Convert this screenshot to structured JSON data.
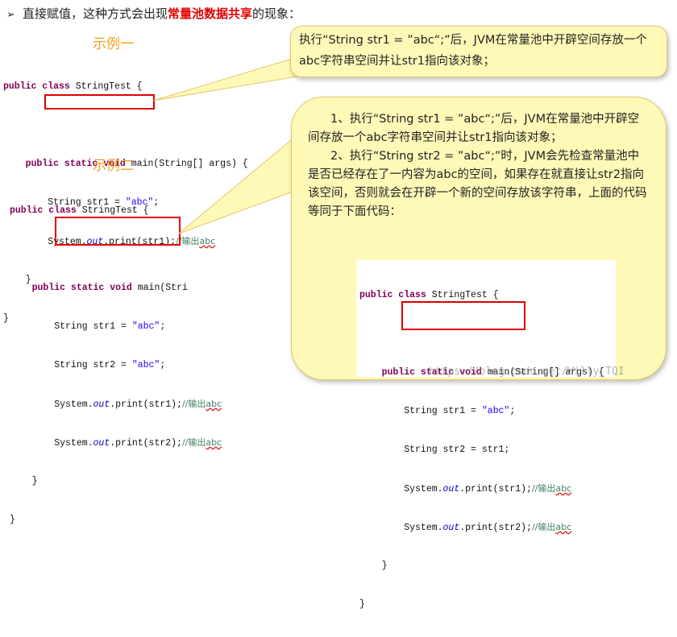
{
  "header": {
    "arrow": "➢",
    "prefix": "直接赋值，这种方式会出现",
    "highlight": "常量池数据共享",
    "suffix": "的现象："
  },
  "example1": {
    "title": "示例一",
    "code": {
      "class_decl": "public class StringTest {",
      "main_decl": "    public static void main(String[] args) {",
      "line1": "String str1 = \"abc\";",
      "print1": "System.out.print(str1);//输出abc",
      "close_method": "}",
      "close_class": "}"
    }
  },
  "example2": {
    "title": "示例二",
    "code": {
      "class_decl": "public class StringTest {",
      "main_decl": "    public static void main(Stri",
      "line1": "String str1 = \"abc\";",
      "line2": "String str2 = \"abc\";",
      "print1": "System.out.print(str1);//输出abc",
      "print2": "System.out.print(str2);//输出abc",
      "close_method": "}",
      "close_class": "}"
    }
  },
  "callout1": {
    "text": "执行“String str1 = ”abc“;”后，JVM在常量池中开辟空间存放一个abc字符串空间并让str1指向该对象；"
  },
  "callout2": {
    "p1": "1、执行“String str1 = ”abc“;”后，JVM在常量池中开辟空间存放一个abc字符串空间并让str1指向该对象；",
    "p2": "2、执行“String str2 = ”abc“;”时，JVM会先检查常量池中是否已经存在了一内容为abc的空间，如果存在就直接让str2指向该空间，否则就会在开辟一个新的空间存放该字符串，上面的代码等同于下面代码：",
    "code": {
      "class_decl": "public class StringTest {",
      "main_decl": "    public static void main(String[] args) {",
      "line1": "String str1 = \"abc\";",
      "line2": "String str2 = str1;",
      "print1": "System.out.print(str1);//输出abc",
      "print2": "System.out.print(str2);//输出abc",
      "close_method": "}",
      "close_class": "}"
    }
  },
  "watermark": "https://blog.csdn.net/Willy_TQI",
  "colors": {
    "highlight": "#e00000",
    "example_title": "#f0a020",
    "callout_bg": "#fff9b8",
    "keyword": "#7f0055",
    "string": "#2a00ff",
    "box": "#e00000"
  }
}
